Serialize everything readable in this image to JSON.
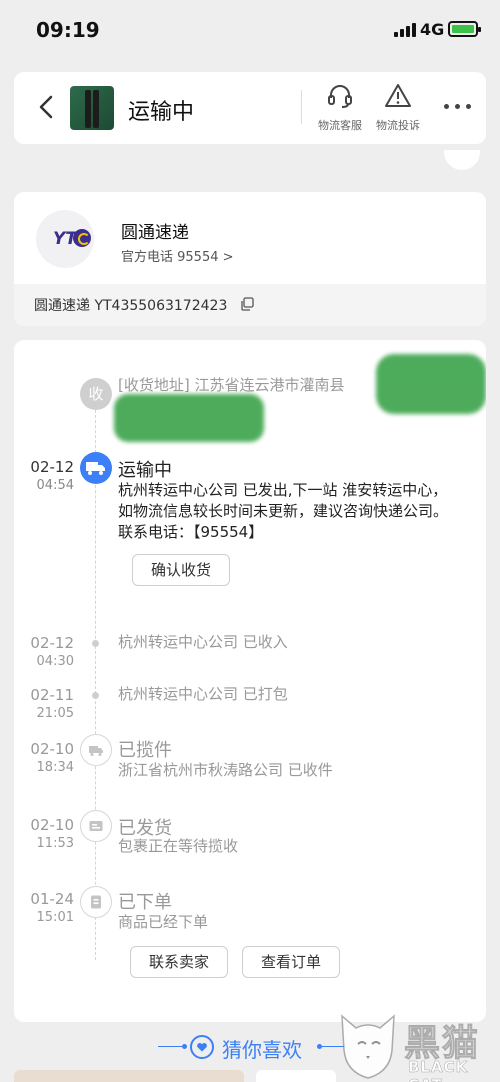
{
  "status_bar": {
    "time": "09:19",
    "network": "4G"
  },
  "header": {
    "title": "运输中",
    "service_label": "物流客服",
    "complaint_label": "物流投诉"
  },
  "carrier": {
    "logo_text": "YT",
    "name": "圆通速递",
    "phone": "官方电话 95554 >",
    "tracking": "圆通速递 YT4355063172423"
  },
  "timeline": {
    "address_node": "收",
    "address": "[收货地址] 江苏省连云港市灌南县",
    "events": [
      {
        "date": "02-12",
        "time": "04:54",
        "status": "运输中",
        "desc": "杭州转运中心公司 已发出,下一站 淮安转运中心，如物流信息较长时间未更新，建议咨询快递公司。联系电话：【95554】",
        "button": "确认收货"
      },
      {
        "date": "02-12",
        "time": "04:30",
        "desc": "杭州转运中心公司 已收入"
      },
      {
        "date": "02-11",
        "time": "21:05",
        "desc": "杭州转运中心公司 已打包"
      },
      {
        "date": "02-10",
        "time": "18:34",
        "status": "已揽件",
        "desc": "浙江省杭州市秋涛路公司 已收件"
      },
      {
        "date": "02-10",
        "time": "11:53",
        "status": "已发货",
        "desc": "包裹正在等待揽收"
      },
      {
        "date": "01-24",
        "time": "15:01",
        "status": "已下单",
        "desc": "商品已经下单"
      }
    ],
    "contact_seller": "联系卖家",
    "view_order": "查看订单"
  },
  "guess": {
    "label": "猜你喜欢"
  },
  "watermark": {
    "title": "黑猫",
    "subtitle": "BLACK CAT"
  },
  "colors": {
    "accent": "#3d7ff6",
    "background": "#eeeeee",
    "logo": "#3a2f8f"
  }
}
